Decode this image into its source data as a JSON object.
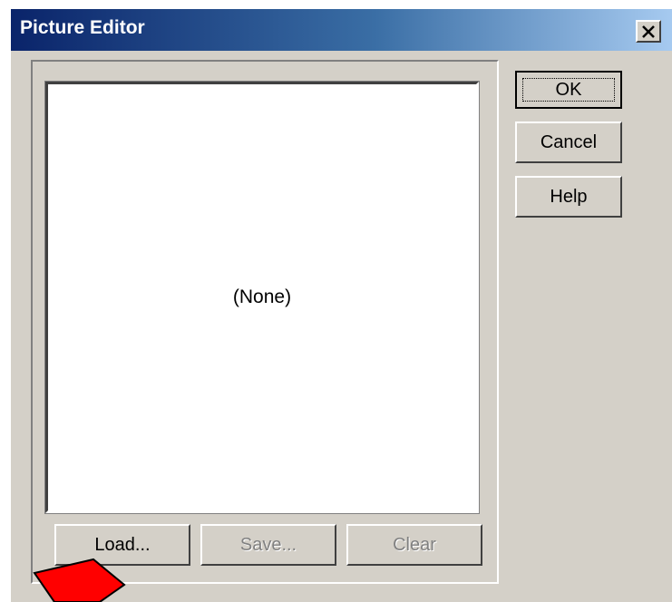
{
  "window": {
    "title": "Picture Editor",
    "close_icon": "close-icon"
  },
  "preview": {
    "text": "(None)"
  },
  "buttons": {
    "ok": "OK",
    "cancel": "Cancel",
    "help": "Help",
    "load": "Load...",
    "save": "Save...",
    "clear": "Clear"
  },
  "colors": {
    "dialog_face": "#d4d0c8",
    "titlebar_start": "#0a246a",
    "titlebar_end": "#a6caf0",
    "annotation_arrow": "#ff0000"
  }
}
